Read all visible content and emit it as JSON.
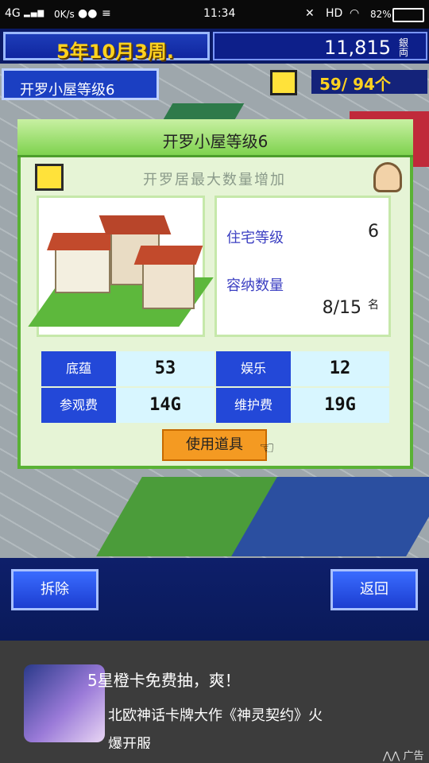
{
  "status_bar": {
    "network": "4G",
    "speed": "0K/s",
    "time": "11:34",
    "hd": "HD",
    "battery": "82%"
  },
  "header": {
    "date": "5年10月3周.",
    "money": "11,815",
    "money_unit": "銀両"
  },
  "banner": {
    "title": "开罗小屋等级6"
  },
  "counter": {
    "value": "59/ 94个"
  },
  "dialog": {
    "title": "开罗小屋等级6",
    "subtitle": "开罗居最大数量增加",
    "info": {
      "housing_level_label": "住宅等级",
      "housing_level_value": "6",
      "capacity_label": "容纳数量",
      "capacity_value": "8/15",
      "capacity_unit": "名"
    },
    "stats": [
      {
        "label": "底蕴",
        "value": "53"
      },
      {
        "label": "娱乐",
        "value": "12"
      },
      {
        "label": "参观费",
        "value": "14G"
      },
      {
        "label": "维护费",
        "value": "19G"
      }
    ],
    "use_item_button": "使用道具"
  },
  "bottom_nav": {
    "remove_button": "拆除",
    "back_button": "返回"
  },
  "ad": {
    "line1": "5星橙卡免费抽，爽！",
    "line2": "北欧神话卡牌大作《神灵契约》火",
    "line3": "爆开服",
    "ad_label": "广告"
  }
}
